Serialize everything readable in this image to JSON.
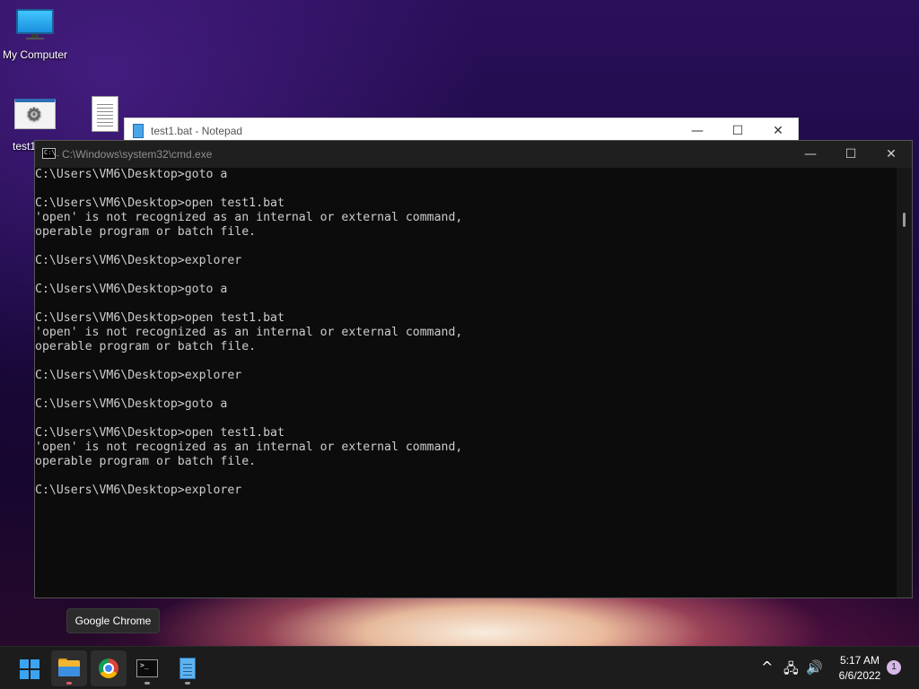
{
  "desktop": {
    "icons": [
      {
        "label": "My Computer",
        "icon": "monitor-icon"
      },
      {
        "label": "test1",
        "icon": "batch-file-icon"
      },
      {
        "label": "",
        "icon": "text-document-icon"
      }
    ]
  },
  "notepad": {
    "title": "test1.bat - Notepad",
    "minimize": "—",
    "maximize": "☐",
    "close": "✕"
  },
  "cmd": {
    "title": "C:\\Windows\\system32\\cmd.exe",
    "icon_text": "C:\\_",
    "minimize": "—",
    "maximize": "☐",
    "close": "✕",
    "lines": [
      "C:\\Users\\VM6\\Desktop>goto a",
      "",
      "C:\\Users\\VM6\\Desktop>open test1.bat",
      "'open' is not recognized as an internal or external command,",
      "operable program or batch file.",
      "",
      "C:\\Users\\VM6\\Desktop>explorer",
      "",
      "C:\\Users\\VM6\\Desktop>goto a",
      "",
      "C:\\Users\\VM6\\Desktop>open test1.bat",
      "'open' is not recognized as an internal or external command,",
      "operable program or batch file.",
      "",
      "C:\\Users\\VM6\\Desktop>explorer",
      "",
      "C:\\Users\\VM6\\Desktop>goto a",
      "",
      "C:\\Users\\VM6\\Desktop>open test1.bat",
      "'open' is not recognized as an internal or external command,",
      "operable program or batch file.",
      "",
      "C:\\Users\\VM6\\Desktop>explorer"
    ]
  },
  "tooltip": {
    "text": "Google Chrome"
  },
  "taskbar": {
    "apps": [
      {
        "name": "start",
        "icon": "windows-logo-icon"
      },
      {
        "name": "file-explorer",
        "icon": "folder-icon",
        "running": true
      },
      {
        "name": "google-chrome",
        "icon": "chrome-icon",
        "hovered": true
      },
      {
        "name": "command-prompt",
        "icon": "terminal-icon",
        "running": true
      },
      {
        "name": "notepad",
        "icon": "notepad-icon",
        "running": true
      }
    ],
    "tray": {
      "chevron": "^",
      "network": "🖧",
      "volume": "🔊",
      "time": "5:17 AM",
      "date": "6/6/2022",
      "notifications": "1"
    }
  },
  "colors": {
    "console_bg": "#0c0c0c",
    "console_fg": "#cccccc",
    "taskbar_bg": "#1c1c1c",
    "accent": "#3ba4f0"
  }
}
